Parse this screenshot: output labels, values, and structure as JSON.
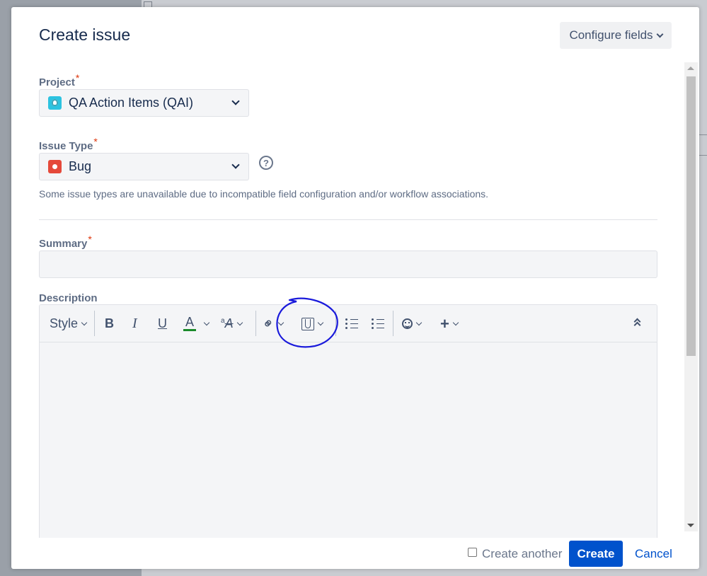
{
  "dialog": {
    "title": "Create issue",
    "configure_label": "Configure fields"
  },
  "fields": {
    "project": {
      "label": "Project",
      "required_mark": "*",
      "value": "QA Action Items (QAI)",
      "icon": "project-avatar-icon"
    },
    "issue_type": {
      "label": "Issue Type",
      "required_mark": "*",
      "value": "Bug",
      "icon": "bug-icon",
      "help_glyph": "?",
      "hint": "Some issue types are unavailable due to incompatible field configuration and/or workflow associations."
    },
    "summary": {
      "label": "Summary",
      "required_mark": "*",
      "value": ""
    },
    "description": {
      "label": "Description",
      "toolbar": {
        "style_label": "Style",
        "bold": "B",
        "italic": "I",
        "underline": "U",
        "font_color": "A",
        "text_format_small": "a",
        "text_format_large": "A",
        "plus": "+",
        "link_glyph": "⚭"
      }
    }
  },
  "footer": {
    "create_another_label": "Create another",
    "create_another_checked": false,
    "create_label": "Create",
    "cancel_label": "Cancel"
  },
  "colors": {
    "primary": "#0052cc",
    "required": "#de350b",
    "annotation": "#1a1adb",
    "font_color_bar": "#1a8a2a"
  }
}
